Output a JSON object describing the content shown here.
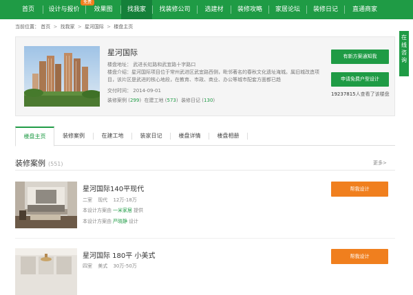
{
  "colors": {
    "brand_green": "#1f9b45",
    "accent_orange": "#f07f1e"
  },
  "nav": {
    "items": [
      {
        "label": "首页"
      },
      {
        "label": "设计与报价"
      },
      {
        "label": "效果图"
      },
      {
        "label": "找我家"
      },
      {
        "label": "找装修公司"
      },
      {
        "label": "选建材"
      },
      {
        "label": "装修攻略"
      },
      {
        "label": "家居论坛"
      },
      {
        "label": "装修日记"
      },
      {
        "label": "直通商家"
      }
    ],
    "badge": "免费",
    "active_index": 3
  },
  "breadcrumb": {
    "prefix": "当前位置：",
    "items": [
      "首页",
      "找我家",
      "星河国际",
      "楼盘主页"
    ],
    "separator": ">"
  },
  "estate": {
    "name": "星河国际",
    "address_label": "楼盘地址：",
    "address": "武进长虹路和武宜路十字路口",
    "intro_label": "楼盘介绍：",
    "intro": "星河国际项目位于常州武进区武宜路西侧，毗邻著名的春秋文化遗址淹城。属旧城改造项目，该片区是武进的核心地段，在教育、市政、商业、办公等城市配套方面都已趋",
    "delivery_label": "交付时间：",
    "delivery": "2014-09-01",
    "stats": {
      "cases_label": "装修案例",
      "cases": "299",
      "sites_label": "在建工地",
      "sites": "573",
      "diaries_label": "装修日记",
      "diaries": "130"
    },
    "btn_notify": "有新方案通知我",
    "btn_free_design": "申请免费户型设计",
    "viewers_count": "19237815",
    "viewers_text": "人查看了该楼盘"
  },
  "consult": {
    "chars": [
      "在",
      "线",
      "咨",
      "询"
    ]
  },
  "tabs": [
    "楼盘主页",
    "装修案例",
    "在建工地",
    "装家日记",
    "楼盘详情",
    "楼盘相册"
  ],
  "section": {
    "title": "装修案例",
    "count": "(551)",
    "more": "更多>"
  },
  "cases": [
    {
      "title": "星河国际140平现代",
      "layout": "二室",
      "style": "现代",
      "budget": "12万-18万",
      "plan_prefix": "本设计方案由",
      "plan_by": "一米家居",
      "plan_suffix": "提供",
      "designer_prefix": "本设计方案由",
      "designer": "严晓静",
      "designer_suffix": "设计",
      "cta": "帮我设计"
    },
    {
      "title": "星河国际 180平 小美式",
      "layout": "四室",
      "style": "美式",
      "budget": "30万-50万",
      "cta": "帮我设计"
    }
  ]
}
